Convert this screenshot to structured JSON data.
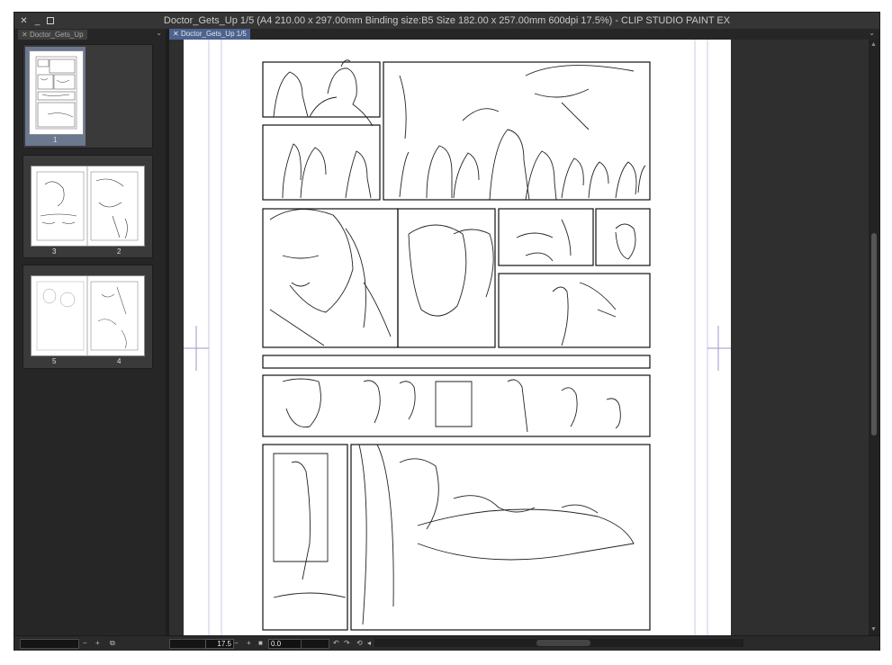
{
  "window": {
    "title": "Doctor_Gets_Up 1/5 (A4 210.00 x 297.00mm Binding size:B5 Size 182.00 x 257.00mm 600dpi 17.5%)  - CLIP STUDIO PAINT EX",
    "close_glyph": "✕",
    "minimize_glyph": "_"
  },
  "left_panel": {
    "tab_label": "Doctor_Gets_Up",
    "tab_close": "✕",
    "chevron": "⌄",
    "pages": [
      {
        "labels": [
          "1"
        ],
        "selected": true
      },
      {
        "labels": [
          "3",
          "2"
        ],
        "selected": false
      },
      {
        "labels": [
          "5",
          "4"
        ],
        "selected": false
      }
    ]
  },
  "canvas_tab": {
    "label": "Doctor_Gets_Up 1/5",
    "close": "✕",
    "chevron": "⌄"
  },
  "bottom_bar": {
    "zoom_value": "17.5",
    "minus": "−",
    "plus": "+",
    "rotation_value": "0.0",
    "left_minus": "−",
    "left_plus": "+"
  },
  "colors": {
    "accent_tab": "#4c6390",
    "selected_page": "#6a7890",
    "background": "#2b2b2b"
  }
}
